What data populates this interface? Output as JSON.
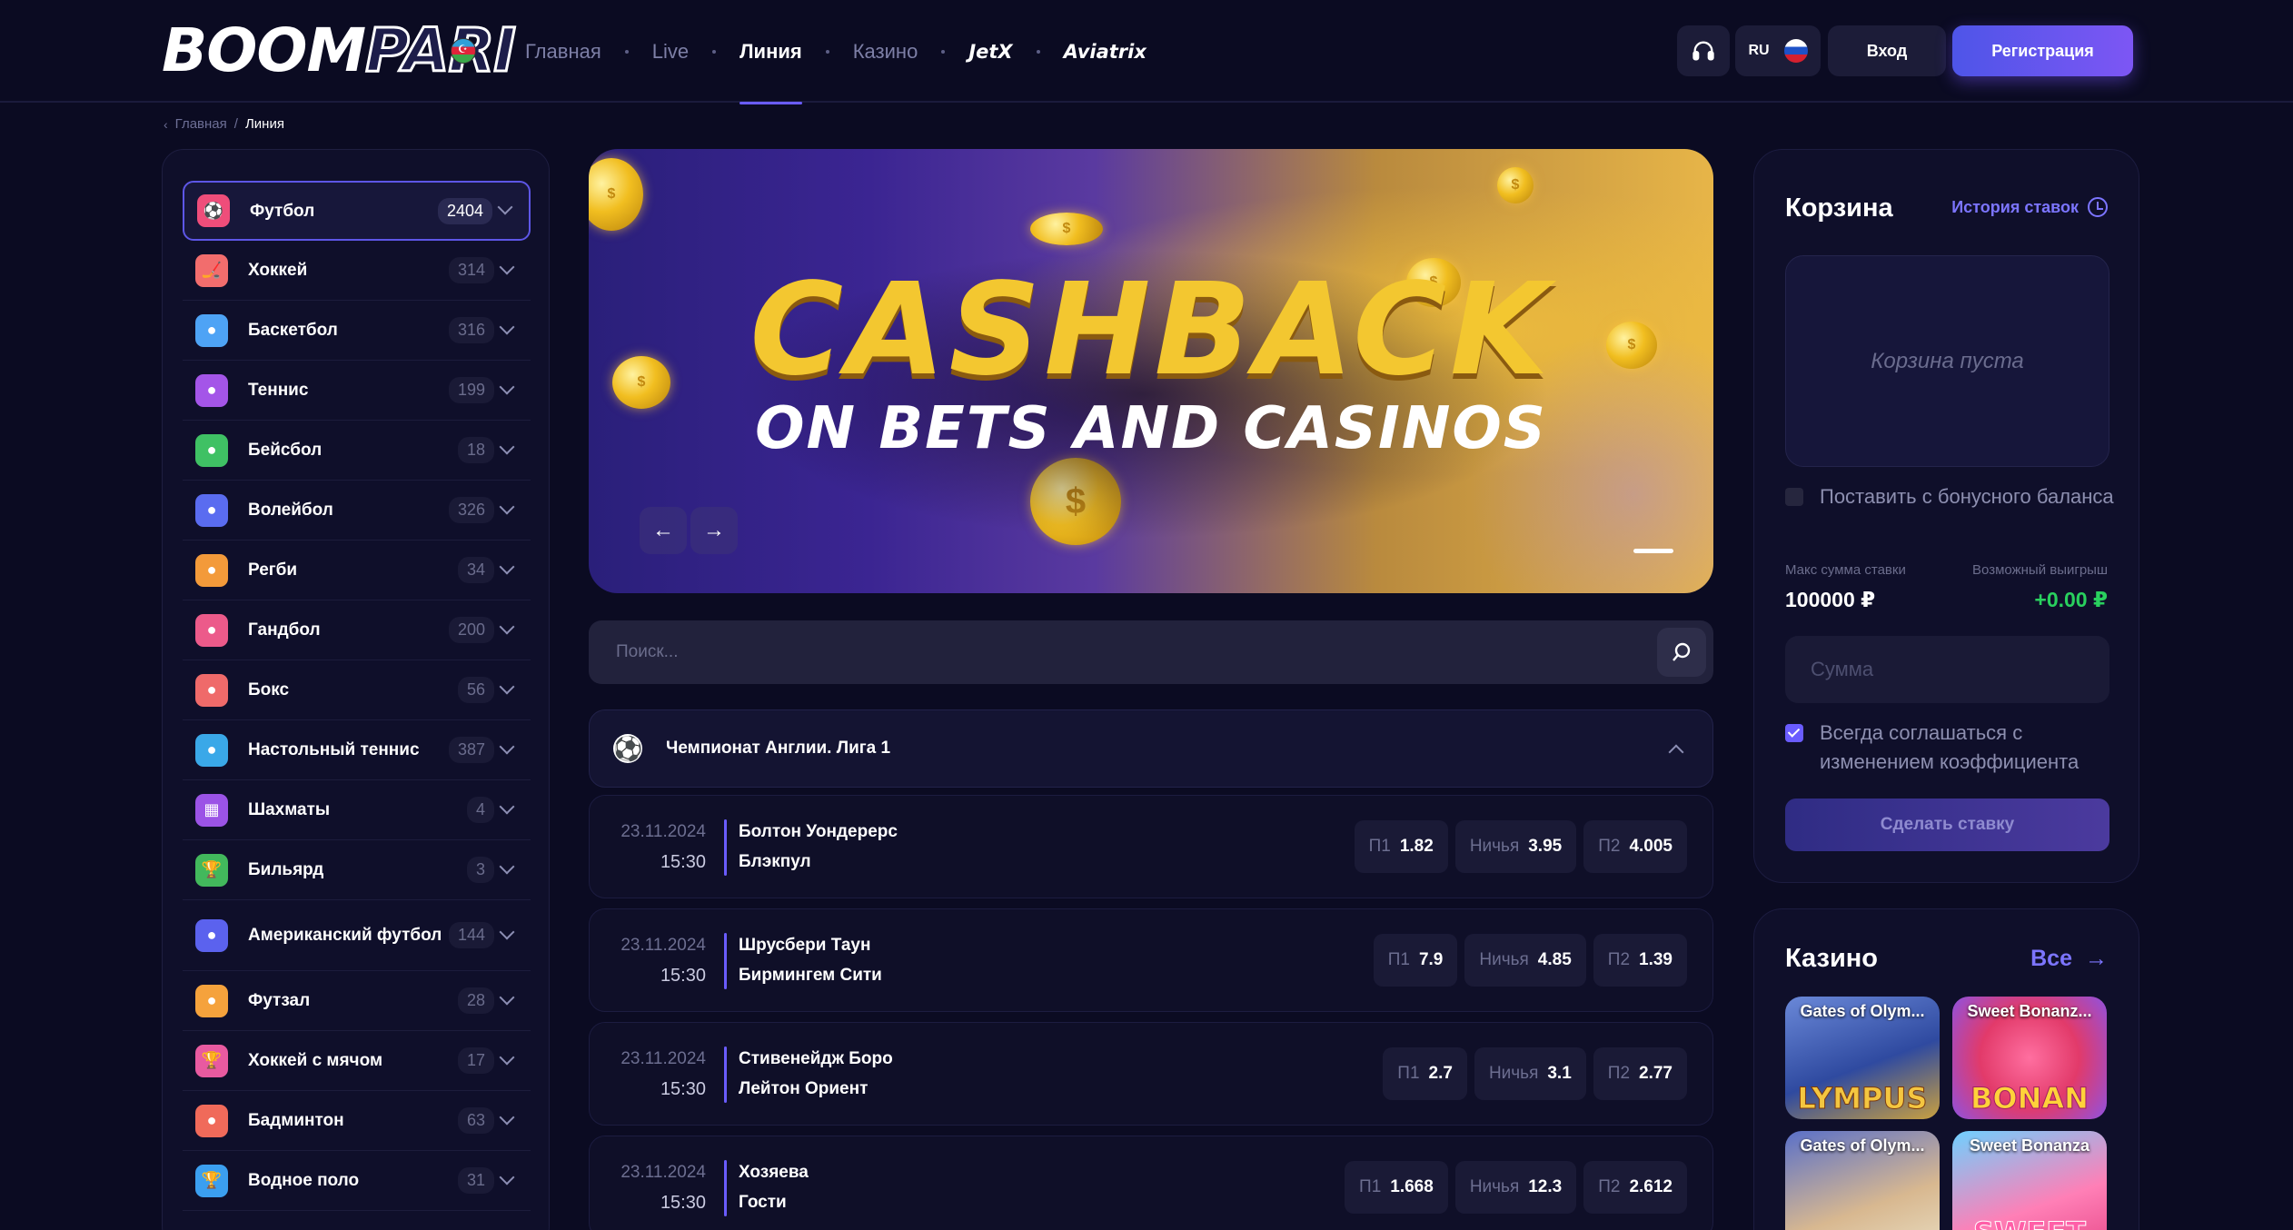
{
  "header": {
    "logo_part1": "BOOM",
    "logo_part2": "PARI",
    "nav": [
      {
        "label": "Главная",
        "active": false
      },
      {
        "label": "Live",
        "active": false
      },
      {
        "label": "Линия",
        "active": true
      },
      {
        "label": "Казино",
        "active": false
      }
    ],
    "brand_jetx": "JetX",
    "brand_aviatrix": "Aviatrix",
    "lang": "RU",
    "login_label": "Вход",
    "register_label": "Регистрация"
  },
  "breadcrumb": {
    "home": "Главная",
    "sep": "/",
    "current": "Линия"
  },
  "sports": [
    {
      "name": "Футбол",
      "count": "2404",
      "icon": "soccer-icon",
      "color": "#ef4d7a",
      "glyph": "⚽",
      "active": true
    },
    {
      "name": "Хоккей",
      "count": "314",
      "icon": "hockey-icon",
      "color": "#f26d6d",
      "glyph": "🏒"
    },
    {
      "name": "Баскетбол",
      "count": "316",
      "icon": "basketball-icon",
      "color": "#4ea3f5",
      "glyph": "●"
    },
    {
      "name": "Теннис",
      "count": "199",
      "icon": "tennis-icon",
      "color": "#a455e8",
      "glyph": "●"
    },
    {
      "name": "Бейсбол",
      "count": "18",
      "icon": "baseball-icon",
      "color": "#3fc164",
      "glyph": "●"
    },
    {
      "name": "Волейбол",
      "count": "326",
      "icon": "volleyball-icon",
      "color": "#5a6cf0",
      "glyph": "●"
    },
    {
      "name": "Регби",
      "count": "34",
      "icon": "rugby-icon",
      "color": "#f39a3a",
      "glyph": "●"
    },
    {
      "name": "Гандбол",
      "count": "200",
      "icon": "handball-icon",
      "color": "#ec5a8a",
      "glyph": "●"
    },
    {
      "name": "Бокс",
      "count": "56",
      "icon": "boxing-icon",
      "color": "#ef6a6a",
      "glyph": "●"
    },
    {
      "name": "Настольный теннис",
      "count": "387",
      "icon": "table-tennis-icon",
      "color": "#3aa8e8",
      "glyph": "●"
    },
    {
      "name": "Шахматы",
      "count": "4",
      "icon": "chess-icon",
      "color": "#9b53e6",
      "glyph": "▦"
    },
    {
      "name": "Бильярд",
      "count": "3",
      "icon": "billiards-icon",
      "color": "#42b85c",
      "glyph": "🏆"
    },
    {
      "name": "Американский футбол",
      "count": "144",
      "icon": "american-football-icon",
      "color": "#5b62ee",
      "glyph": "●"
    },
    {
      "name": "Футзал",
      "count": "28",
      "icon": "futsal-icon",
      "color": "#f5a23c",
      "glyph": "●"
    },
    {
      "name": "Хоккей с мячом",
      "count": "17",
      "icon": "bandy-icon",
      "color": "#e85aa0",
      "glyph": "🏆"
    },
    {
      "name": "Бадминтон",
      "count": "63",
      "icon": "badminton-icon",
      "color": "#f06a5a",
      "glyph": "●"
    },
    {
      "name": "Водное поло",
      "count": "31",
      "icon": "water-polo-icon",
      "color": "#3b9ff0",
      "glyph": "🏆"
    }
  ],
  "banner": {
    "title": "CASHBACK",
    "subtitle": "ON BETS AND CASINOS"
  },
  "search": {
    "placeholder": "Поиск..."
  },
  "league": {
    "name": "Чемпионат Англии. Лига 1"
  },
  "matches": [
    {
      "date": "23.11.2024",
      "time": "15:30",
      "team1": "Болтон Уондерерс",
      "team2": "Блэкпул",
      "odds": [
        {
          "label": "П1",
          "value": "1.82"
        },
        {
          "label": "Ничья",
          "value": "3.95"
        },
        {
          "label": "П2",
          "value": "4.005"
        }
      ]
    },
    {
      "date": "23.11.2024",
      "time": "15:30",
      "team1": "Шрусбери Таун",
      "team2": "Бирмингем Сити",
      "odds": [
        {
          "label": "П1",
          "value": "7.9"
        },
        {
          "label": "Ничья",
          "value": "4.85"
        },
        {
          "label": "П2",
          "value": "1.39"
        }
      ]
    },
    {
      "date": "23.11.2024",
      "time": "15:30",
      "team1": "Стивенейдж Боро",
      "team2": "Лейтон Ориент",
      "odds": [
        {
          "label": "П1",
          "value": "2.7"
        },
        {
          "label": "Ничья",
          "value": "3.1"
        },
        {
          "label": "П2",
          "value": "2.77"
        }
      ]
    },
    {
      "date": "23.11.2024",
      "time": "15:30",
      "team1": "Хозяева",
      "team2": "Гости",
      "odds": [
        {
          "label": "П1",
          "value": "1.668"
        },
        {
          "label": "Ничья",
          "value": "12.3"
        },
        {
          "label": "П2",
          "value": "2.612"
        }
      ]
    }
  ],
  "cart": {
    "title": "Корзина",
    "history_label": "История ставок",
    "empty_text": "Корзина пуста",
    "bonus_label": "Поставить с бонусного баланса",
    "bonus_checked": false,
    "max_label": "Макс сумма ставки",
    "max_value": "100000 ₽",
    "win_label": "Возможный выигрыш",
    "win_value": "+0.00 ₽",
    "sum_placeholder": "Сумма",
    "agree_label": "Всегда соглашаться с изменением коэффициента",
    "agree_checked": true,
    "bet_label": "Сделать ставку"
  },
  "casino": {
    "title": "Казино",
    "all_label": "Все",
    "games": [
      {
        "title": "Gates of Olym...",
        "art": "LYMPUS"
      },
      {
        "title": "Sweet Bonanz...",
        "art": "BONAN"
      },
      {
        "title": "Gates of Olym...",
        "art": ""
      },
      {
        "title": "Sweet Bonanza",
        "art": "SWEET"
      }
    ]
  }
}
